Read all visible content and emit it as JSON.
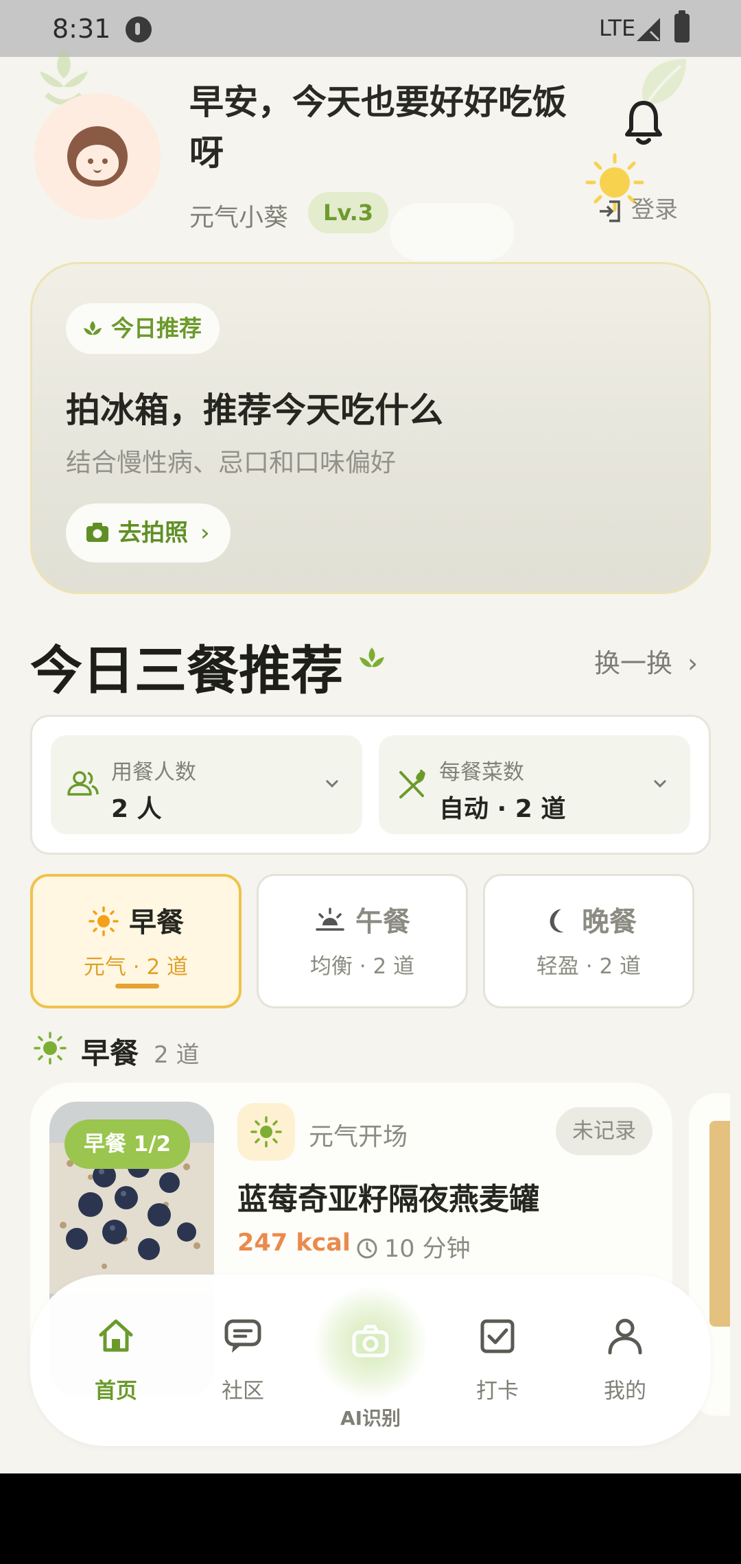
{
  "status_bar": {
    "time": "8:31",
    "network": "LTE"
  },
  "header": {
    "greeting": "早安，今天也要好好吃饭呀",
    "username": "元气小葵",
    "level": "Lv.3",
    "login_label": "登录"
  },
  "recommend_card": {
    "chip": "今日推荐",
    "title": "拍冰箱，推荐今天吃什么",
    "subtitle": "结合慢性病、忌口和口味偏好",
    "button": "去拍照"
  },
  "section": {
    "title": "今日三餐推荐",
    "shuffle": "换一换"
  },
  "options": {
    "diners": {
      "label": "用餐人数",
      "value": "2 人"
    },
    "dishes": {
      "label": "每餐菜数",
      "value": "自动 · 2 道"
    }
  },
  "meals": [
    {
      "name": "早餐",
      "desc": "元气 · 2 道",
      "active": true
    },
    {
      "name": "午餐",
      "desc": "均衡 · 2 道",
      "active": false
    },
    {
      "name": "晚餐",
      "desc": "轻盈 · 2 道",
      "active": false
    }
  ],
  "breakfast": {
    "heading": "早餐",
    "count": "2 道",
    "card": {
      "tag": "早餐 1/2",
      "subtitle": "元气开场",
      "status": "未记录",
      "name": "蓝莓奇亚籽隔夜燕麦罐",
      "kcal": "247 kcal",
      "time": "10 分钟"
    }
  },
  "bottom_nav": [
    {
      "label": "首页",
      "icon": "home-icon"
    },
    {
      "label": "社区",
      "icon": "chat-icon"
    },
    {
      "label": "AI识别",
      "icon": "camera-icon"
    },
    {
      "label": "打卡",
      "icon": "checkbox-icon"
    },
    {
      "label": "我的",
      "icon": "person-icon"
    }
  ],
  "colors": {
    "accent_green": "#6b9a2b",
    "accent_orange": "#ea8a4c",
    "meal_active_border": "#f0c24a"
  }
}
